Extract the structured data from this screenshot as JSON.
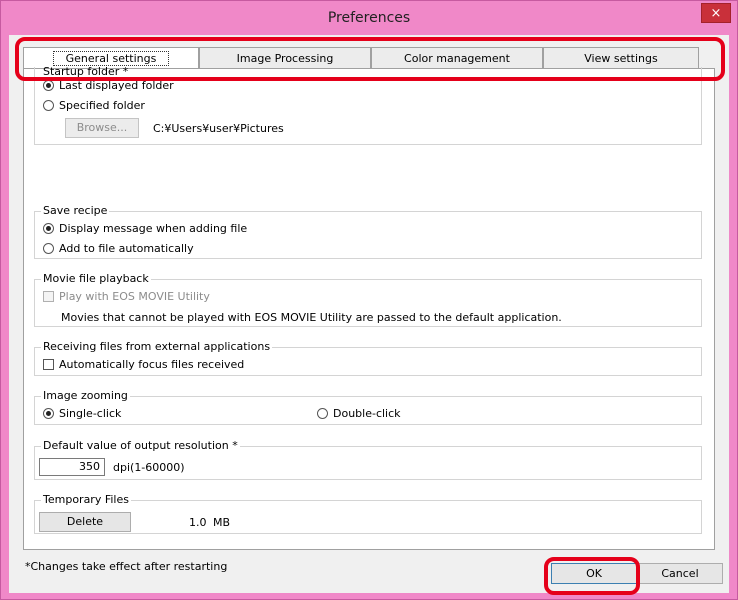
{
  "window": {
    "title": "Preferences",
    "close_label": "×"
  },
  "tabs": [
    {
      "label": "General settings"
    },
    {
      "label": "Image Processing"
    },
    {
      "label": "Color management"
    },
    {
      "label": "View settings"
    }
  ],
  "startup": {
    "title": "Startup folder *",
    "opt_last": "Last displayed folder",
    "opt_specified": "Specified folder",
    "browse": "Browse...",
    "path": "C:¥Users¥user¥Pictures"
  },
  "save_recipe": {
    "title": "Save recipe",
    "opt_display": "Display message when adding file",
    "opt_auto": "Add to file automatically"
  },
  "movie": {
    "title": "Movie file playback",
    "opt_play": "Play with EOS MOVIE Utility",
    "note": "Movies that cannot be played with EOS MOVIE Utility are passed to the default application."
  },
  "receiving": {
    "title": "Receiving files from external applications",
    "opt_focus": "Automatically focus files received"
  },
  "zoom": {
    "title": "Image zooming",
    "opt_single": "Single-click",
    "opt_double": "Double-click"
  },
  "resolution": {
    "title": "Default value of output resolution *",
    "value": "350",
    "unit": "dpi(1-60000)"
  },
  "temp": {
    "title": "Temporary Files",
    "delete": "Delete",
    "size": "1.0",
    "size_unit": "MB"
  },
  "footer": {
    "note": "*Changes take effect after restarting",
    "ok": "OK",
    "cancel": "Cancel"
  },
  "highlight_color": "#e5001a"
}
